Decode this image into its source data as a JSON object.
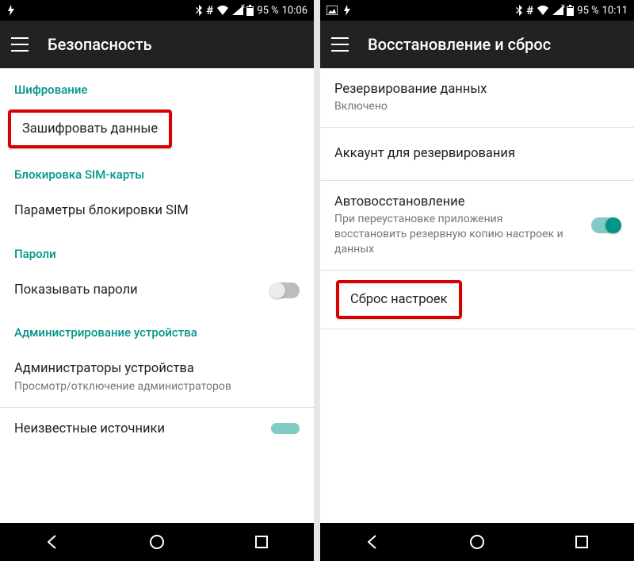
{
  "phones": {
    "left": {
      "status": {
        "battery": "95 %",
        "time": "10:06"
      },
      "appbar": {
        "title": "Безопасность"
      },
      "sections": {
        "encryption_header": "Шифрование",
        "encrypt_data": "Зашифровать данные",
        "sim_lock_header": "Блокировка SIM-карты",
        "sim_lock_params": "Параметры блокировки SIM",
        "passwords_header": "Пароли",
        "show_passwords": "Показывать пароли",
        "device_admin_header": "Администрирование устройства",
        "device_admins_title": "Администраторы устройства",
        "device_admins_sub": "Просмотр/отключение администраторов",
        "unknown_sources": "Неизвестные источники"
      }
    },
    "right": {
      "status": {
        "battery": "95 %",
        "time": "10:11"
      },
      "appbar": {
        "title": "Восстановление и сброс"
      },
      "items": {
        "backup_data_title": "Резервирование данных",
        "backup_data_sub": "Включено",
        "backup_account_title": "Аккаунт для резервирования",
        "auto_restore_title": "Автовосстановление",
        "auto_restore_sub": "При переустановке приложения восстановить резервную копию настроек и данных",
        "factory_reset": "Сброс настроек"
      }
    }
  }
}
